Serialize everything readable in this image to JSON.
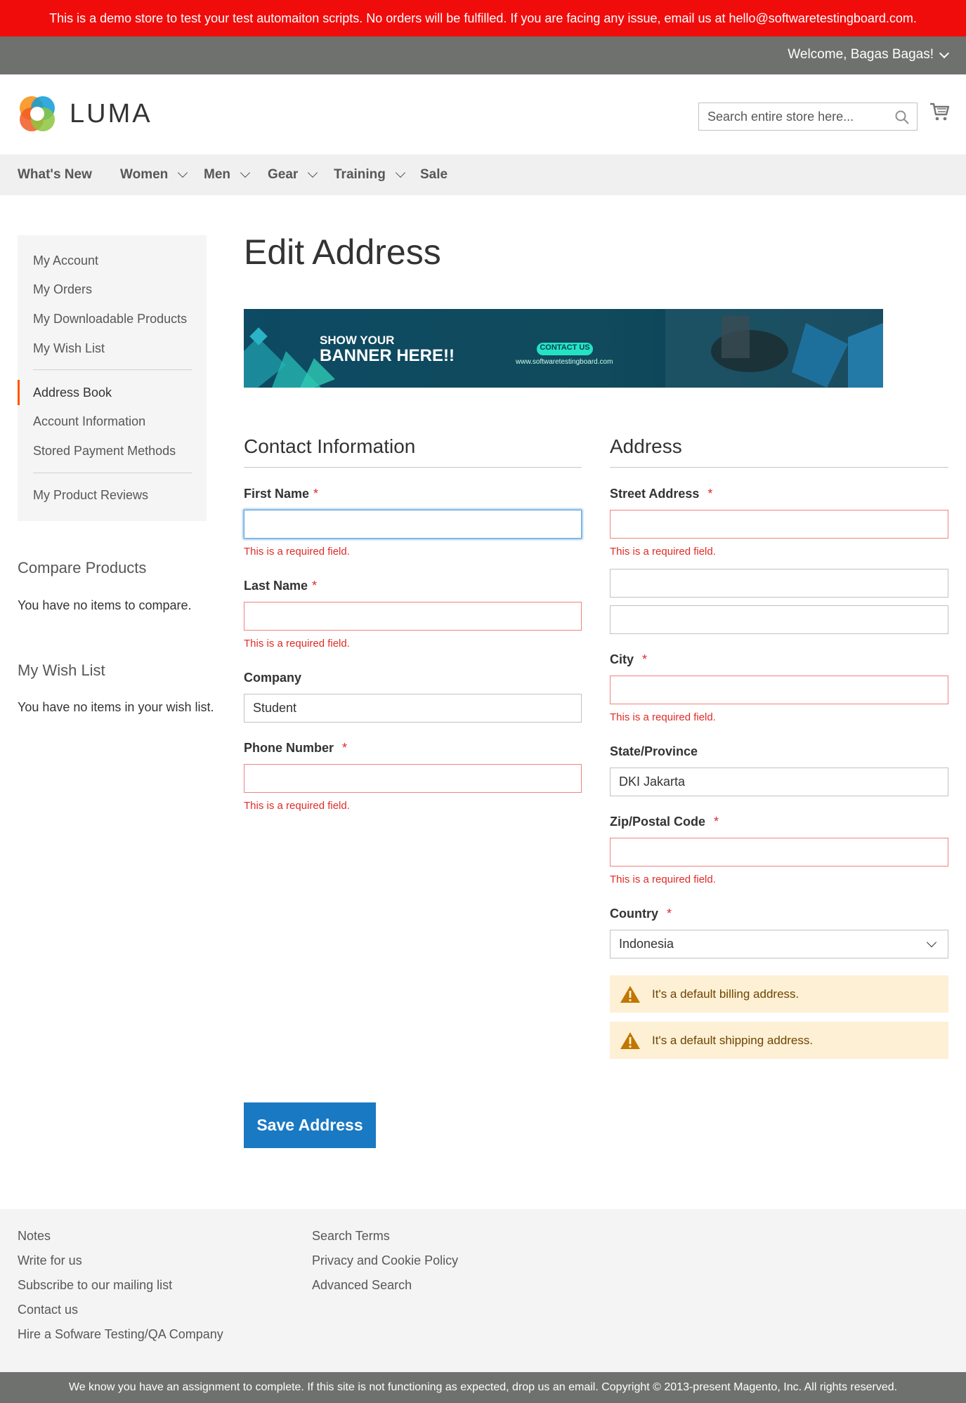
{
  "demo_notice": "This is a demo store to test your test automaiton scripts. No orders will be fulfilled. If you are facing any issue, email us at hello@softwaretestingboard.com.",
  "header": {
    "welcome": "Welcome, Bagas Bagas!",
    "logo_text": "LUMA",
    "search_placeholder": "Search entire store here..."
  },
  "nav": {
    "items": [
      {
        "label": "What's New"
      },
      {
        "label": "Women"
      },
      {
        "label": "Men"
      },
      {
        "label": "Gear"
      },
      {
        "label": "Training"
      },
      {
        "label": "Sale"
      }
    ]
  },
  "sidebar": {
    "items": [
      {
        "label": "My Account"
      },
      {
        "label": "My Orders"
      },
      {
        "label": "My Downloadable Products"
      },
      {
        "label": "My Wish List"
      },
      {
        "label": "Address Book"
      },
      {
        "label": "Account Information"
      },
      {
        "label": "Stored Payment Methods"
      },
      {
        "label": "My Product Reviews"
      }
    ],
    "compare_title": "Compare Products",
    "compare_text": "You have no items to compare.",
    "wishlist_title": "My Wish List",
    "wishlist_text": "You have no items in your wish list."
  },
  "page_title": "Edit Address",
  "banner": {
    "line1": "SHOW YOUR",
    "line2": "BANNER HERE!!",
    "button": "CONTACT US",
    "url": "www.softwaretestingboard.com"
  },
  "contact": {
    "legend": "Contact Information",
    "first_name_label": "First Name",
    "first_name_value": "",
    "last_name_label": "Last Name",
    "last_name_value": "",
    "company_label": "Company",
    "company_value": "Student",
    "phone_label": "Phone Number",
    "phone_value": ""
  },
  "address": {
    "legend": "Address",
    "street_label": "Street Address",
    "city_label": "City",
    "state_label": "State/Province",
    "state_value": "DKI Jakarta",
    "zip_label": "Zip/Postal Code",
    "country_label": "Country",
    "country_value": "Indonesia",
    "billing_notice": "It's a default billing address.",
    "shipping_notice": "It's a default shipping address."
  },
  "required_mark": "*",
  "required_error": "This is a required field.",
  "save_button": "Save Address",
  "footer": {
    "col1": [
      "Notes",
      "Write for us",
      "Subscribe to our mailing list",
      "Contact us",
      "Hire a Sofware Testing/QA Company"
    ],
    "col2": [
      "Search Terms",
      "Privacy and Cookie Policy",
      "Advanced Search"
    ],
    "copyright": "We know you have an assignment to complete. If this site is not functioning as expected, drop us an email. Copyright © 2013-present Magento, Inc. All rights reserved."
  },
  "colors": {
    "demo_bar": "#f10c0c",
    "top_bar": "#6e716e",
    "primary_button": "#1979c3",
    "error": "#e02b27",
    "active_accent": "#ff5501",
    "notice_bg": "#fdf0d5"
  }
}
